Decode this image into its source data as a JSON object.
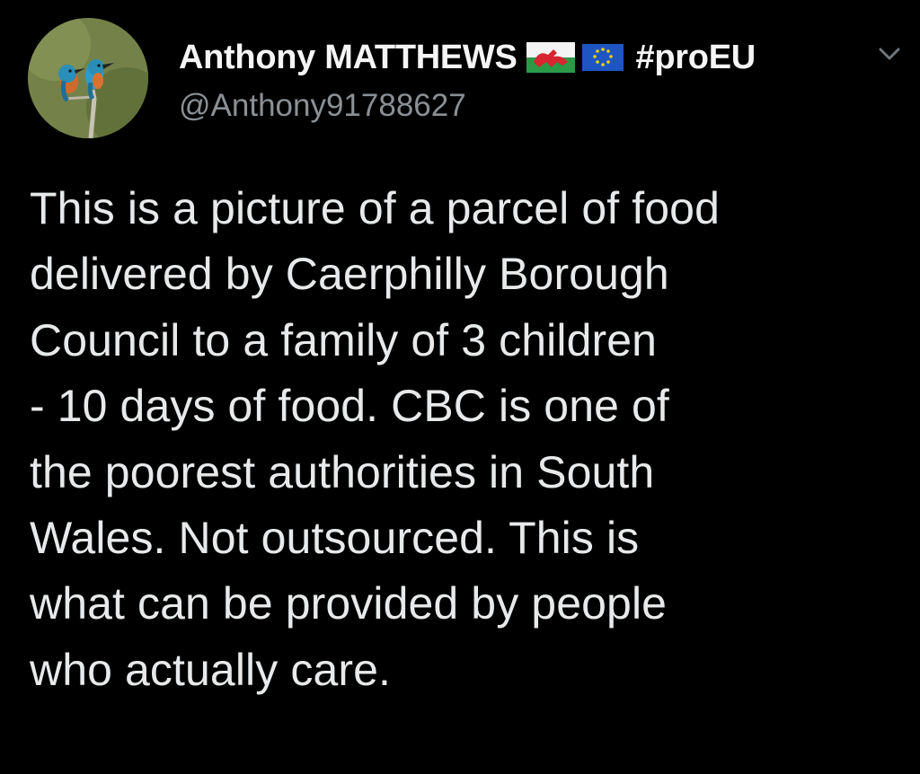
{
  "tweet": {
    "display_name": "Anthony MATTHEWS",
    "name_suffix": "#proEU",
    "handle": "@Anthony91788627",
    "flags": [
      "wales-flag-icon",
      "eu-flag-icon"
    ],
    "avatar": "kingfisher-birds-avatar",
    "text": "This is a picture of a parcel of food\ndelivered by Caerphilly Borough\nCouncil to a family of 3 children\n- 10 days of food. CBC is one of\nthe poorest authorities in South\nWales. Not outsourced. This is\nwhat can be provided by people\nwho actually care."
  },
  "colors": {
    "background": "#000000",
    "text": "#e7e9ea",
    "handle": "#8b9095"
  }
}
